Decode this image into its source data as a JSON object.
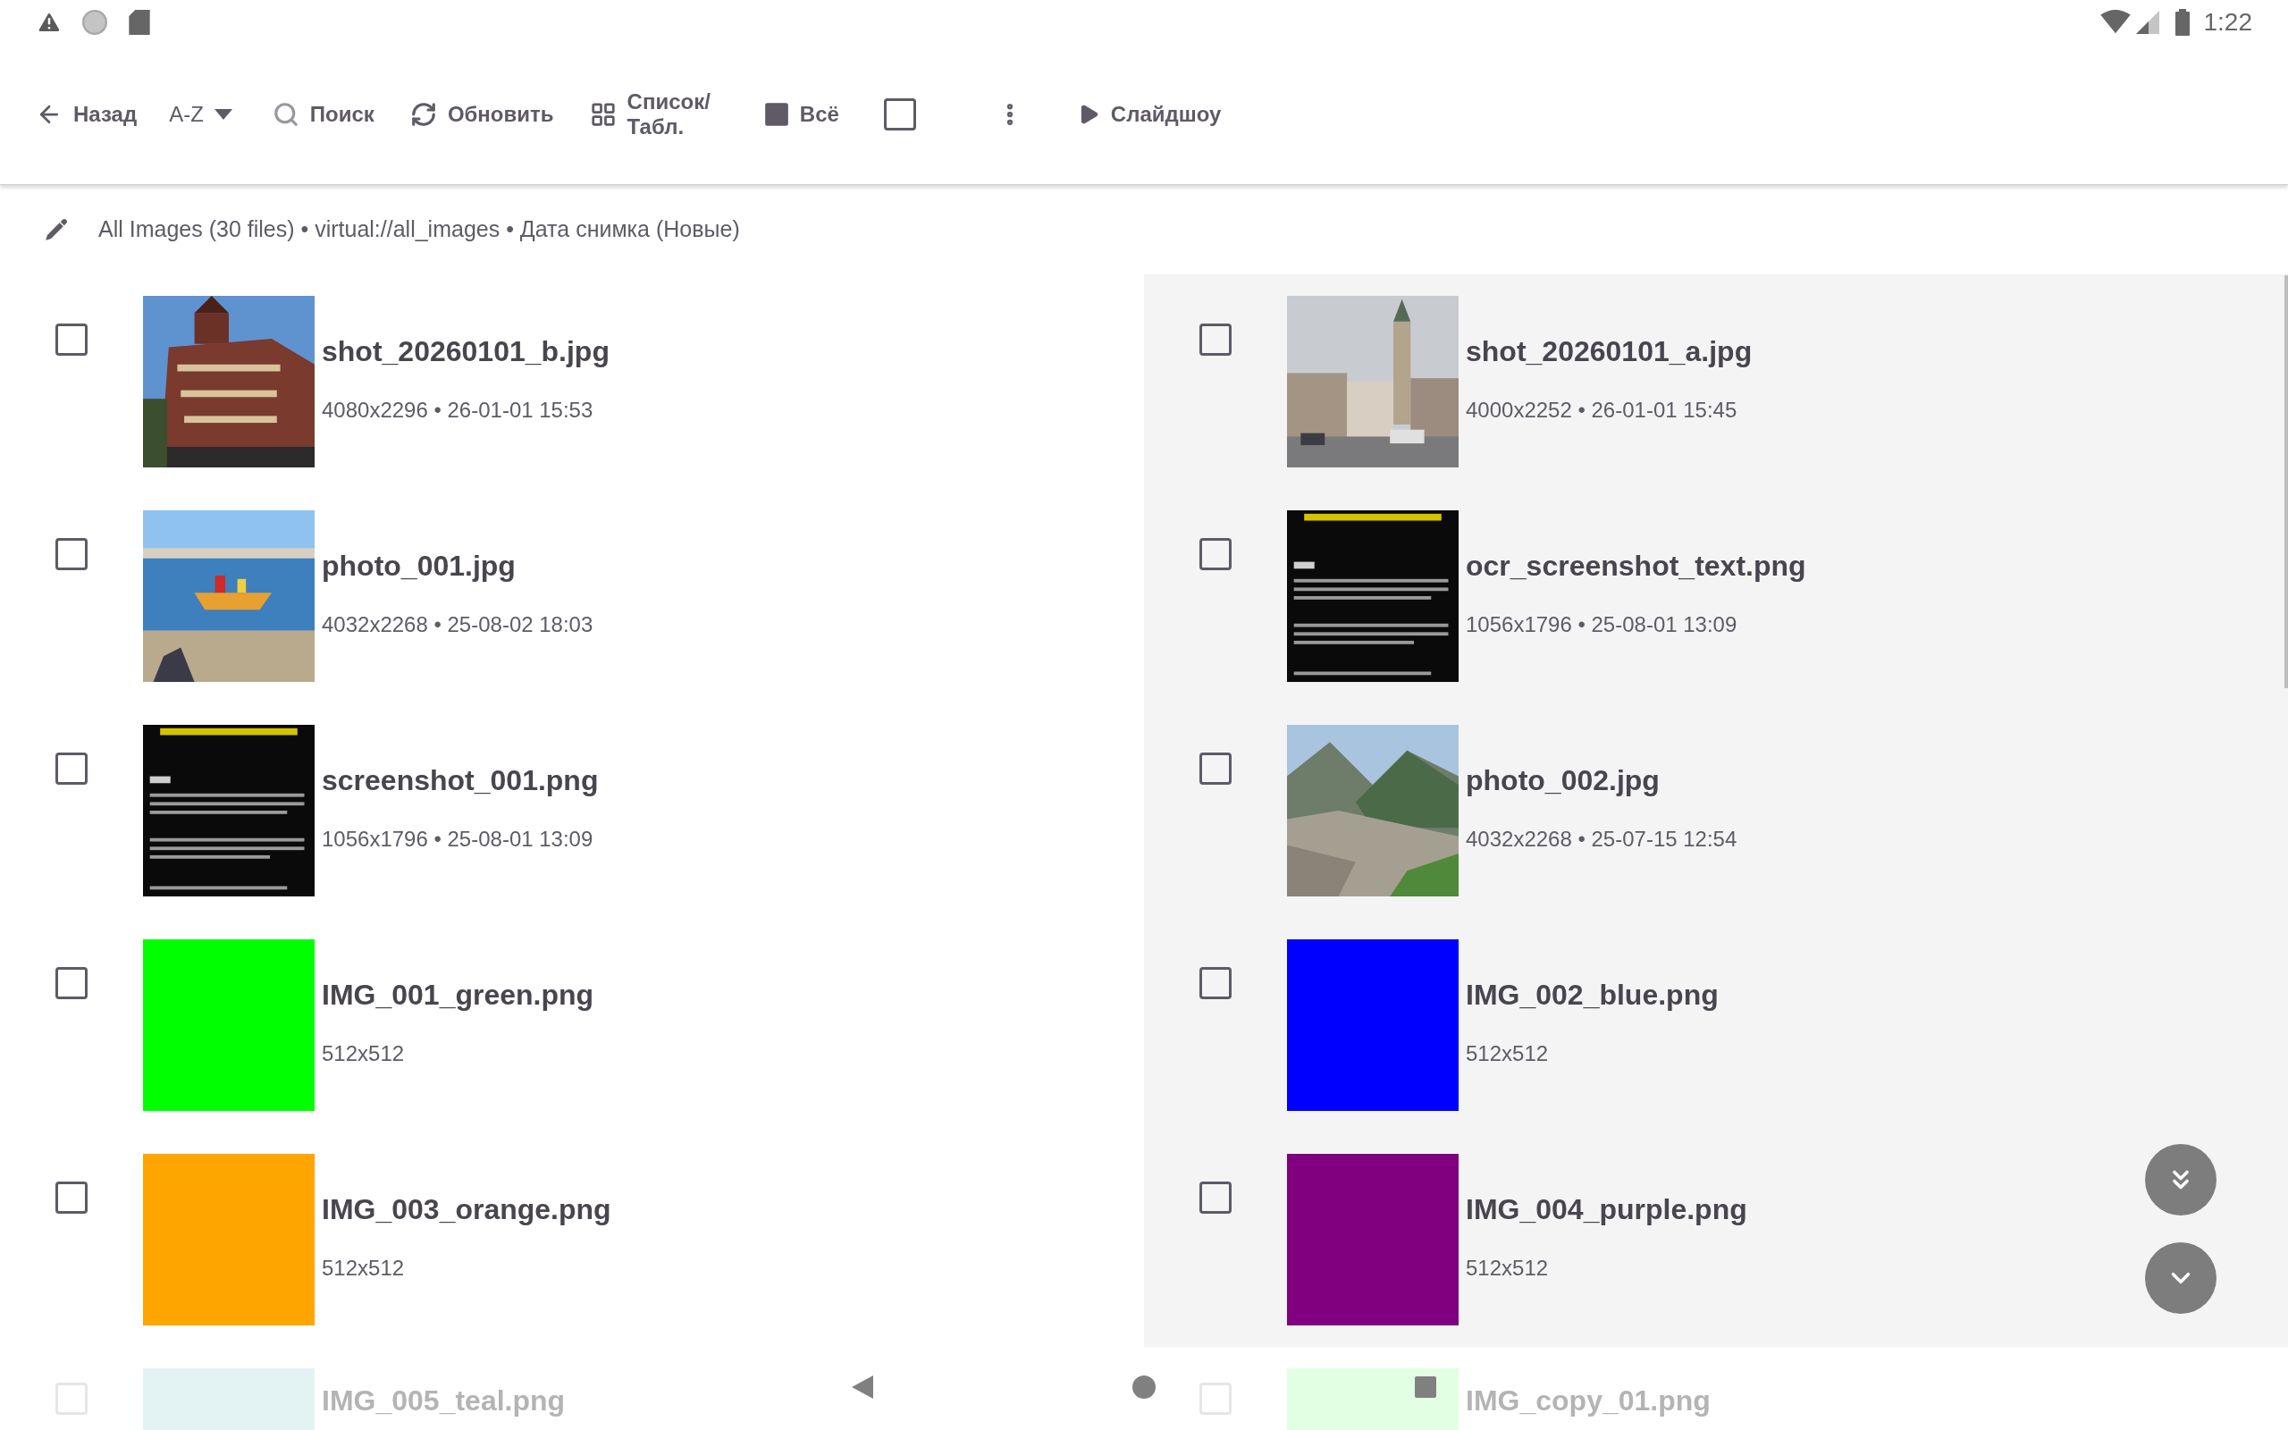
{
  "status_bar": {
    "time": "1:22"
  },
  "toolbar": {
    "items": [
      {
        "kind": "back",
        "label": "Назад"
      },
      {
        "kind": "sort",
        "label": "A-Z"
      },
      {
        "kind": "search",
        "label": "Поиск"
      },
      {
        "kind": "refresh",
        "label": "Обновить"
      },
      {
        "kind": "view",
        "label": "Список/\nТабл."
      },
      {
        "kind": "select_all",
        "label": "Всё"
      },
      {
        "kind": "checkbox",
        "checked": false
      },
      {
        "kind": "more"
      },
      {
        "kind": "slideshow",
        "label": "Слайдшоу"
      }
    ]
  },
  "breadcrumb": "All Images (30 files) • virtual://all_images • Дата снимка (Новые)",
  "items": [
    {
      "name": "shot_20260101_b.jpg",
      "meta": "4080x2296 • 26-01-01 15:53",
      "checked": false,
      "dimmed": false
    },
    {
      "name": "shot_20260101_a.jpg",
      "meta": "4000x2252 • 26-01-01 15:45",
      "checked": false,
      "dimmed": false
    },
    {
      "name": "photo_001.jpg",
      "meta": "4032x2268 • 25-08-02 18:03",
      "checked": false,
      "dimmed": false
    },
    {
      "name": "ocr_screenshot_text.png",
      "meta": "1056x1796 • 25-08-01 13:09",
      "checked": false,
      "dimmed": false
    },
    {
      "name": "screenshot_001.png",
      "meta": "1056x1796 • 25-08-01 13:09",
      "checked": false,
      "dimmed": false
    },
    {
      "name": "photo_002.jpg",
      "meta": "4032x2268 • 25-07-15 12:54",
      "checked": false,
      "dimmed": false
    },
    {
      "name": "IMG_001_green.png",
      "meta": "512x512",
      "checked": false,
      "dimmed": false,
      "thumb": {
        "kind": "color",
        "color": "#00ff00"
      }
    },
    {
      "name": "IMG_002_blue.png",
      "meta": "512x512",
      "checked": false,
      "dimmed": false,
      "thumb": {
        "kind": "color",
        "color": "#0000ff"
      }
    },
    {
      "name": "IMG_003_orange.png",
      "meta": "512x512",
      "checked": false,
      "dimmed": false,
      "thumb": {
        "kind": "color",
        "color": "#ffa500"
      }
    },
    {
      "name": "IMG_004_purple.png",
      "meta": "512x512",
      "checked": false,
      "dimmed": false,
      "thumb": {
        "kind": "color",
        "color": "#800080"
      }
    },
    {
      "name": "IMG_005_teal.png",
      "checked": false,
      "dimmed": true,
      "thumb": {
        "kind": "color",
        "color": "#e3f2f2"
      }
    },
    {
      "name": "IMG_copy_01.png",
      "checked": false,
      "dimmed": true,
      "thumb": {
        "kind": "color",
        "color": "#e3ffe3"
      }
    }
  ]
}
